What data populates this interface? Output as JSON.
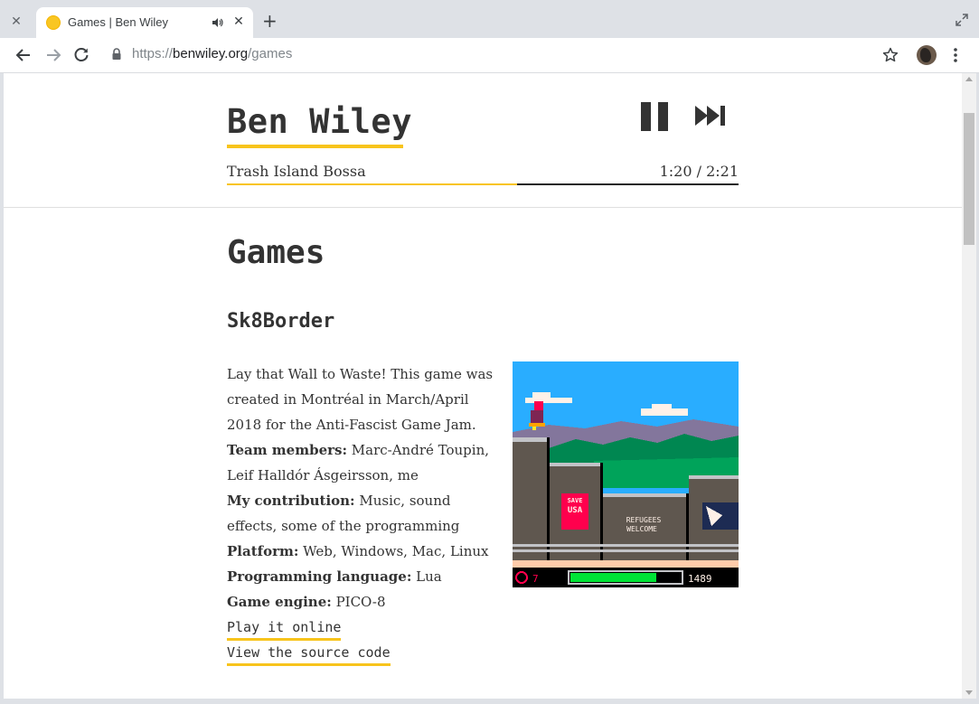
{
  "browser": {
    "tab_title": "Games | Ben Wiley",
    "url_scheme": "https://",
    "url_host": "benwiley.org",
    "url_path": "/games",
    "icons": [
      "close-icon",
      "favicon-icon",
      "audio-icon",
      "plus-icon",
      "maximize-icon",
      "back-icon",
      "forward-icon",
      "reload-icon",
      "lock-icon",
      "star-icon",
      "avatar",
      "menu-icon"
    ]
  },
  "site": {
    "title": "Ben Wiley",
    "accent_color": "#f8c41c"
  },
  "player": {
    "track_name": "Trash Island Bossa",
    "time_display": "1:20 / 2:21",
    "progress_fraction": 0.567
  },
  "page": {
    "heading": "Games"
  },
  "game": {
    "title": "Sk8Border",
    "intro": "Lay that Wall to Waste! This game was created in Montréal in March/April 2018 for the Anti-Fascist Game Jam.",
    "team_label": "Team members:",
    "team_value": " Marc-André Toupin, Leif Halldór Ásgeirsson, me",
    "contribution_label": "My contribution:",
    "contribution_value": " Music, sound effects, some of the programming",
    "platform_label": "Platform:",
    "platform_value": " Web, Windows, Mac, Linux",
    "language_label": "Programming language:",
    "language_value": " Lua",
    "engine_label": "Game engine:",
    "engine_value": " PICO-8",
    "play_link": "Play it online",
    "source_link": "View the source code",
    "screenshot": {
      "sign_left_line1": "SAVE",
      "sign_left_line2": "USA",
      "sign_mid_line1": "REFUGEES",
      "sign_mid_line2": "WELCOME",
      "hud_timer": "7",
      "hud_score": "1489",
      "hud_bar_fraction": 0.78
    }
  }
}
